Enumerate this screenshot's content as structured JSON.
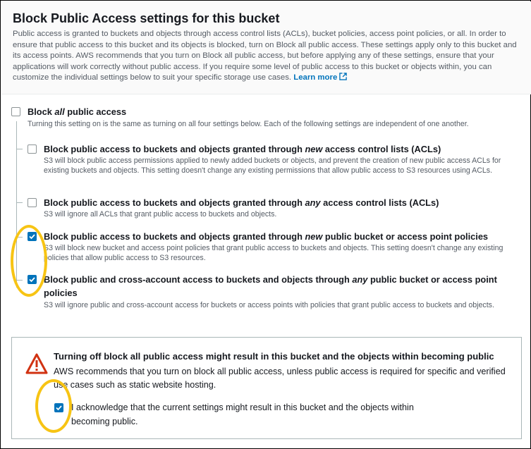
{
  "header": {
    "title": "Block Public Access settings for this bucket",
    "description": "Public access is granted to buckets and objects through access control lists (ACLs), bucket policies, access point policies, or all. In order to ensure that public access to this bucket and its objects is blocked, turn on Block all public access. These settings apply only to this bucket and its access points. AWS recommends that you turn on Block all public access, but before applying any of these settings, ensure that your applications will work correctly without public access. If you require some level of public access to this bucket or objects within, you can customize the individual settings below to suit your specific storage use cases.",
    "learn_more": "Learn more"
  },
  "block_all": {
    "label_before": "Block ",
    "label_em": "all",
    "label_after": " public access",
    "desc": "Turning this setting on is the same as turning on all four settings below. Each of the following settings are independent of one another.",
    "checked": false
  },
  "options": [
    {
      "before": "Block public access to buckets and objects granted through ",
      "em": "new",
      "after": " access control lists (ACLs)",
      "desc": "S3 will block public access permissions applied to newly added buckets or objects, and prevent the creation of new public access ACLs for existing buckets and objects. This setting doesn't change any existing permissions that allow public access to S3 resources using ACLs.",
      "checked": false
    },
    {
      "before": "Block public access to buckets and objects granted through ",
      "em": "any",
      "after": " access control lists (ACLs)",
      "desc": "S3 will ignore all ACLs that grant public access to buckets and objects.",
      "checked": false
    },
    {
      "before": "Block public access to buckets and objects granted through ",
      "em": "new",
      "after": " public bucket or access point policies",
      "desc": "S3 will block new bucket and access point policies that grant public access to buckets and objects. This setting doesn't change any existing policies that allow public access to S3 resources.",
      "checked": true
    },
    {
      "before": "Block public and cross-account access to buckets and objects through ",
      "em": "any",
      "after": " public bucket or access point policies",
      "desc": "S3 will ignore public and cross-account access for buckets or access points with policies that grant public access to buckets and objects.",
      "checked": true
    }
  ],
  "warning": {
    "title": "Turning off block all public access might result in this bucket and the objects within becoming public",
    "desc": "AWS recommends that you turn on block all public access, unless public access is required for specific and verified use cases such as static website hosting.",
    "ack": "I acknowledge that the current settings might result in this bucket and the objects within becoming public.",
    "ack_checked": true
  },
  "colors": {
    "accent": "#0073bb",
    "warning": "#d13212",
    "highlight": "#f7c414"
  }
}
